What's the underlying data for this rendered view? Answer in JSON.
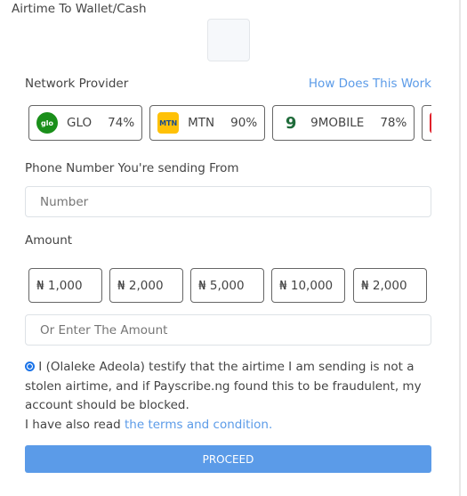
{
  "title": "Airtime To Wallet/Cash",
  "network": {
    "label": "Network Provider",
    "help_link": "How Does This Work",
    "providers": [
      {
        "name": "GLO",
        "rate": "74%",
        "color": "#1a8f1a",
        "logo": "glo"
      },
      {
        "name": "MTN",
        "rate": "90%",
        "color": "#ffc107",
        "logo": "MTN"
      },
      {
        "name": "9MOBILE",
        "rate": "78%",
        "color": "#1f6b3a",
        "logo": "9"
      },
      {
        "name": "",
        "rate": "",
        "color": "#e0202a",
        "logo": "airtel"
      }
    ]
  },
  "phone": {
    "label": "Phone Number You're sending From",
    "placeholder": "Number"
  },
  "amount": {
    "label": "Amount",
    "options": [
      "₦ 1,000",
      "₦ 2,000",
      "₦ 5,000",
      "₦ 10,000",
      "₦ 2,000"
    ],
    "placeholder": "Or Enter The Amount"
  },
  "consent": {
    "text": " I (Olaleke Adeola) testify that the airtime I am sending is not a stolen airtime, and if Payscribe.ng found this to be fraudulent, my account should be blocked.",
    "read_prefix": "I have also read ",
    "terms_link": "the terms and condition.",
    "checked": true
  },
  "proceed_label": "PROCEED",
  "colors": {
    "accent": "#5b9be8"
  }
}
